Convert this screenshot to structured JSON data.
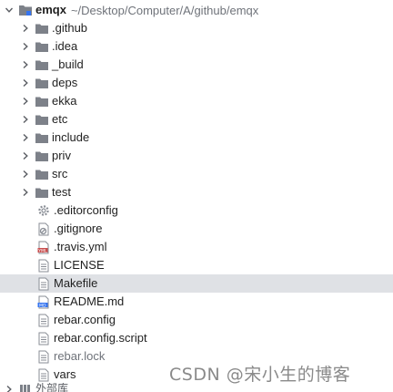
{
  "root": {
    "name": "emqx",
    "path": "~/Desktop/Computer/A/github/emqx"
  },
  "folders": [
    {
      "label": ".github"
    },
    {
      "label": ".idea"
    },
    {
      "label": "_build"
    },
    {
      "label": "deps"
    },
    {
      "label": "ekka"
    },
    {
      "label": "etc"
    },
    {
      "label": "include"
    },
    {
      "label": "priv"
    },
    {
      "label": "src"
    },
    {
      "label": "test"
    }
  ],
  "files": [
    {
      "label": ".editorconfig",
      "icon": "gear-icon"
    },
    {
      "label": ".gitignore",
      "icon": "gitignore-icon"
    },
    {
      "label": ".travis.yml",
      "icon": "yaml-file-icon"
    },
    {
      "label": "LICENSE",
      "icon": "text-file-icon"
    },
    {
      "label": "Makefile",
      "icon": "text-file-icon",
      "selected": true
    },
    {
      "label": "README.md",
      "icon": "markdown-file-icon"
    },
    {
      "label": "rebar.config",
      "icon": "text-file-icon"
    },
    {
      "label": "rebar.config.script",
      "icon": "text-file-icon"
    },
    {
      "label": "rebar.lock",
      "icon": "text-file-icon"
    },
    {
      "label": "vars",
      "icon": "text-file-icon"
    }
  ],
  "external_libraries": {
    "label": "外部库"
  },
  "watermark": "CSDN @宋小生的博客",
  "colors": {
    "folder": "#7d8189",
    "selection": "#dfe1e5",
    "path": "#6f737a"
  }
}
